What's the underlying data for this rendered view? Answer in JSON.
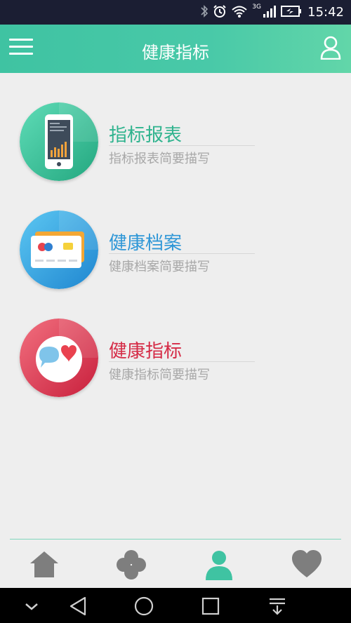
{
  "status_bar": {
    "time": "15:42",
    "network": "3G",
    "icons": [
      "bluetooth-icon",
      "alarm-icon",
      "wifi-icon",
      "signal-icon",
      "battery-icon"
    ]
  },
  "header": {
    "title": "健康指标",
    "menu_icon": "menu-icon",
    "user_icon": "user-icon"
  },
  "items": [
    {
      "title": "指标报表",
      "desc": "指标报表简要描写",
      "color": "#2fb38e",
      "icon": "phone-chart-icon"
    },
    {
      "title": "健康档案",
      "desc": "健康档案简要描写",
      "color": "#2f97d7",
      "icon": "card-icon"
    },
    {
      "title": "健康指标",
      "desc": "健康指标简要描写",
      "color": "#d52b46",
      "icon": "chat-heart-icon"
    }
  ],
  "tabbar": {
    "tabs": [
      "home-icon",
      "clover-icon",
      "person-icon",
      "heart-icon"
    ],
    "active_index": 2,
    "active_color": "#3fc3a2",
    "inactive_color": "#7e7e7e"
  },
  "nav": [
    "chevron-down-icon",
    "back-icon",
    "home-circle-icon",
    "recents-icon",
    "notification-pull-icon"
  ]
}
